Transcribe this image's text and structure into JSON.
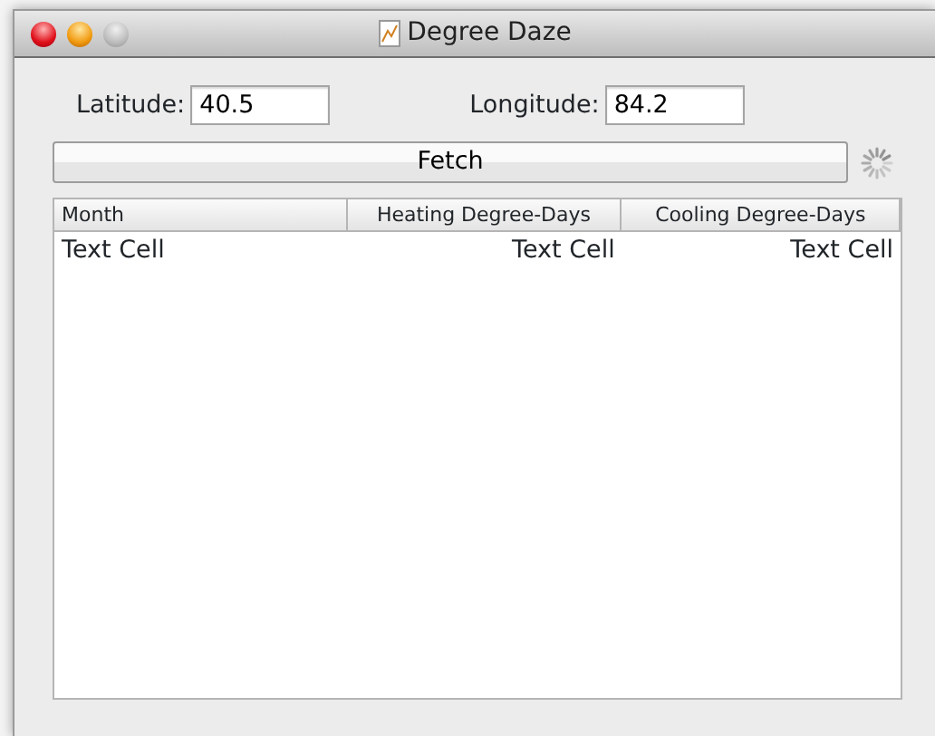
{
  "window": {
    "title": "Degree Daze"
  },
  "fields": [
    {
      "label": "Latitude:",
      "value": "40.5"
    },
    {
      "label": "Longitude:",
      "value": "84.2"
    }
  ],
  "fetch_button": "Fetch",
  "table": {
    "columns": [
      "Month",
      "Heating Degree-Days",
      "Cooling Degree-Days"
    ],
    "rows": [
      [
        "Text Cell",
        "Text Cell",
        "Text Cell"
      ]
    ]
  }
}
